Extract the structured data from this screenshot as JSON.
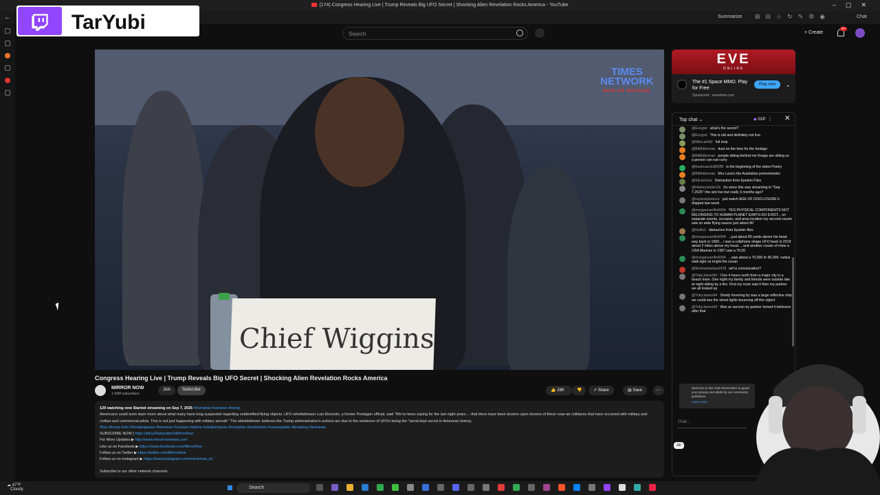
{
  "window": {
    "title": "(174) Congress Hearing Live | Trump Reveals Big UFO Secret | Shocking Alien Revelation Rocks America - YouTube"
  },
  "toolbar": {
    "summarize": "Summarize",
    "chat": "Chat"
  },
  "overlay": {
    "streamer": "TarYubi"
  },
  "youtube": {
    "search_placeholder": "Search",
    "create": "Create",
    "notifications": "9+"
  },
  "video": {
    "nameplate": "Chief Wiggins",
    "logo_line1": "TIMES",
    "logo_line2": "NETWORK",
    "logo_tag": "NOW OR NOTHING",
    "title": "Congress Hearing Live | Trump Reveals Big UFO Secret | Shocking Alien Revelation Rocks America"
  },
  "channel": {
    "name": "MIRROR NOW",
    "subscribers": "1.99M subscribers",
    "join": "Join",
    "subscribe": "Subscribe",
    "likes": "28K",
    "share": "Share",
    "save": "Save"
  },
  "description": {
    "stats": "129 watching now  Started streaming on Sep 7, 2025",
    "tags1": "#trumplive #usnews #trump",
    "body": "Americans could soon learn more about what many have long suspected regarding unidentified flying objects. UFO whistleblower Luis Elizondo, a former Pentagon official, said \"We've been saying for the last eight years ... that there have been dozens upon dozens of these near-air collisions that have occurred with military and civilian and commercial pilots. This is not just happening with military aircraft.\" The whistleblower believes the Trump administration's actions are due to the existence of UFOs being the \"worst-kept secret in American history.",
    "tags2": "#live #trump #ufo #breakingnews #livenews #usnews #aliens #ufodisclosure #trumplive #worldnews #newsupdate #breaking #livenews",
    "subscribe_label": "SUBSCRIBE NOW |",
    "subscribe_link": "https://bit.ly/SubscribeToMirrorNow",
    "updates_label": "For More Updates ▶",
    "updates_link": "http://www.mirrornownews.com",
    "fb_label": "Like us on Facebook ▶",
    "fb_link": "https://www.facebook.com/MirrorNow",
    "tw_label": "Follow us on Twitter ▶",
    "tw_link": "https://twitter.com/MirrorNow",
    "ig_label": "Follow us on Instagram ▶",
    "ig_link": "https://www.instagram.com/mirrornow_in/",
    "other": "Subscribe to our other network channels:"
  },
  "ad": {
    "brand": "EVE",
    "brand_sub": "ONLINE",
    "text": "The #1 Space MMO. Play for Free",
    "sponsored": "Sponsored · eveonline.com",
    "cta": "Play now"
  },
  "chat": {
    "mode": "Top chat",
    "points": "0XP",
    "messages": [
      {
        "author": "@Eurypsi",
        "text": "what's the secret?",
        "color": "#7a8f6a"
      },
      {
        "author": "@Eurypsi",
        "text": "This is old and definitely not live.",
        "color": "#7a8f6a"
      },
      {
        "author": "@NiteLar642",
        "text": "full loop",
        "color": "#8a9a5b"
      },
      {
        "author": "@BillAlderman",
        "text": "dust on the lens for the footage",
        "color": "#e67e22"
      },
      {
        "author": "@BillAlderman",
        "text": "people sitting behind me Knapp are sitting so a person can eat curry",
        "color": "#e67e22"
      },
      {
        "author": "@frankcasolo89289",
        "text": "is the beginning of the video Poetry",
        "color": "#27ae60"
      },
      {
        "author": "@BillAlderman",
        "text": "Mrs Luna's the Australian primeminister",
        "color": "#e67e22"
      },
      {
        "author": "@SA-kei1ivz",
        "text": "Distraction from Epstein Files",
        "color": "#6b7b4b"
      },
      {
        "author": "@HistoryIslold-t2k",
        "text": "So since this was streaming in \"Sep 7,2025\" this isnt live but really 3 months ago?",
        "color": "#888888"
      },
      {
        "author": "@raylenepieterse",
        "text": "just watch AGE OF DISCLOSURE it dripped last week",
        "color": "#777777"
      },
      {
        "author": "@morgancarrillo6004",
        "text": "YES PHYSICAL COMPONENTS NOT BELONGING TO HUMAN PLANET EARTH DO EXIST... on separate events, occasion, and area location my second cousin saw so wide flying saucer just about 80",
        "color": "#2e8b57"
      },
      {
        "author": "@Nellis2",
        "text": "distraction from Epstein files",
        "color": "#9a7a4a"
      },
      {
        "author": "@morgancarrillo6004",
        "text": "...just about 80 yards above his head way back in 1960... i saw a cellphone shape UFO back in 2019 about 2 miles above my head.... and another cousin of mine a USA Marines in 1987 saw a 70,00",
        "color": "#2e8b57"
      },
      {
        "author": "@morgancarrillo6004",
        "text": "...saw about a 70,000 to 90,000. radius wide light so bright the ocean",
        "color": "#2e8b57"
      },
      {
        "author": "@florinsebastian2418",
        "text": "wtf is comunication?",
        "color": "#c0392b"
      },
      {
        "author": "@TobyJames94",
        "text": "I live 4 hours north from a major city in a beach town. One night my family and friends were outside late at night sitting by a fire. First my mum saw it then my partner we all looked up",
        "color": "#777777"
      },
      {
        "author": "@TobyJames94",
        "text": "Slowly hovering by was a large reflective ship we could see the street lights bouncing off this object",
        "color": "#777777"
      },
      {
        "author": "@TobyJames94",
        "text": "Was so surreal my partner turned it believers after that",
        "color": "#777777"
      }
    ],
    "welcome": "Welcome to live chat! Remember to guard your privacy and abide by our community guidelines.",
    "learn_more": "Learn more",
    "input_placeholder": "Chat...",
    "filter_all": "All"
  },
  "taskbar": {
    "temp": "47°F",
    "weather": "Cloudy",
    "search": "Search"
  }
}
